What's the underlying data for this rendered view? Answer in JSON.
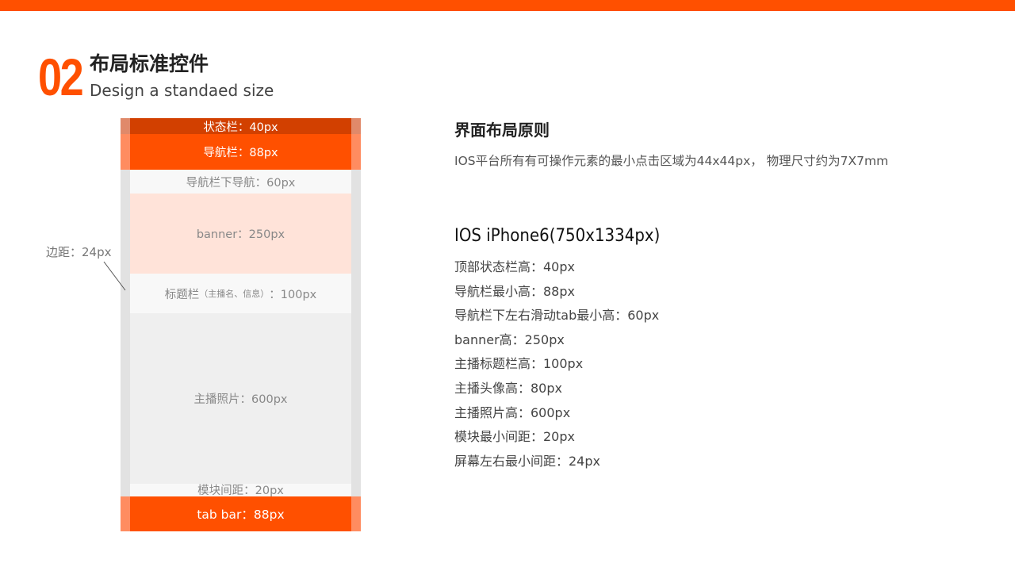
{
  "header": {
    "number": "02",
    "title": "布局标准控件",
    "subtitle": "Design a standaed size"
  },
  "diagram": {
    "status_bar": "状态栏：40px",
    "nav_bar": "导航栏：88px",
    "sub_nav": "导航栏下导航：60px",
    "banner": "banner：250px",
    "title_bar_main": "标题栏",
    "title_bar_note": "（主播名、信息）",
    "title_bar_value": "：100px",
    "photo": "主播照片：600px",
    "module_gap": "模块间距：20px",
    "tab_bar": "tab bar：88px",
    "margin_label": "边距：24px"
  },
  "principles": {
    "heading": "界面布局原则",
    "description": "IOS平台所有有可操作元素的最小点击区域为44x44px，  物理尺寸约为7X7mm"
  },
  "specs": {
    "heading": "IOS iPhone6(750x1334px)",
    "items": [
      "顶部状态栏高：40px",
      "导航栏最小高：88px",
      "导航栏下左右滑动tab最小高：60px",
      "banner高：250px",
      "主播标题栏高：100px",
      "主播头像高：80px",
      "主播照片高：600px",
      "模块最小间距：20px",
      "屏幕左右最小间距：24px"
    ]
  },
  "colors": {
    "accent": "#ff5000",
    "status_bar": "#d24000",
    "banner_tint": "#ffe3d9",
    "margin_strip": "#e2e2e2"
  }
}
